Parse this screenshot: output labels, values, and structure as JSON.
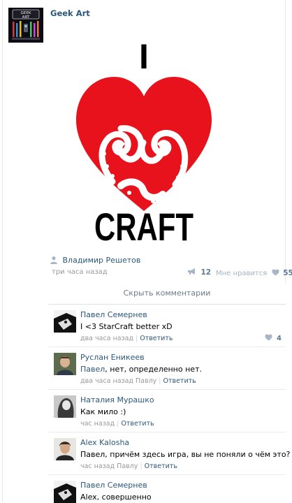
{
  "post": {
    "group_name": "Geek Art",
    "group_logo_text": [
      "GEEK",
      "ART"
    ],
    "image_text_top": "I",
    "image_text_bottom": "CRAFT",
    "author": "Владимир Решетов",
    "time": "три часа назад",
    "reposts": "12",
    "like_label": "Мне нравится",
    "likes": "55",
    "collapse_comments_label": "Скрыть комментарии"
  },
  "comments": [
    {
      "author": "Павел Семернев",
      "reply_to": "",
      "text": "I <3 StarCraft better xD",
      "time": "два часа назад",
      "reply_label": "Ответить",
      "likes": "4"
    },
    {
      "author": "Руслан Еникеев",
      "reply_to": "Павел",
      "text": ", нет, определенно нет.",
      "time": "два часа назад Павлу",
      "reply_label": "Ответить",
      "likes": ""
    },
    {
      "author": "Наталия Мурашко",
      "reply_to": "",
      "text": "Как мило :)",
      "time": "час назад",
      "reply_label": "Ответить",
      "likes": ""
    },
    {
      "author": "Alex Kalosha",
      "reply_to": "",
      "text": "Павел, причём здесь игра, вы не поняли о чём это?",
      "time": "час назад Павлу",
      "reply_label": "Ответить",
      "likes": ""
    },
    {
      "author": "Павел Семернев",
      "reply_to": "",
      "text": "Alex, совершенно",
      "time": "",
      "reply_label": "",
      "likes": ""
    }
  ],
  "colors": {
    "link": "#2b587a",
    "heart_red": "#e8121c",
    "meta_gray": "#999999",
    "border": "#e4e8ed"
  },
  "icons": [
    "person-icon",
    "megaphone-icon",
    "heart-icon"
  ]
}
